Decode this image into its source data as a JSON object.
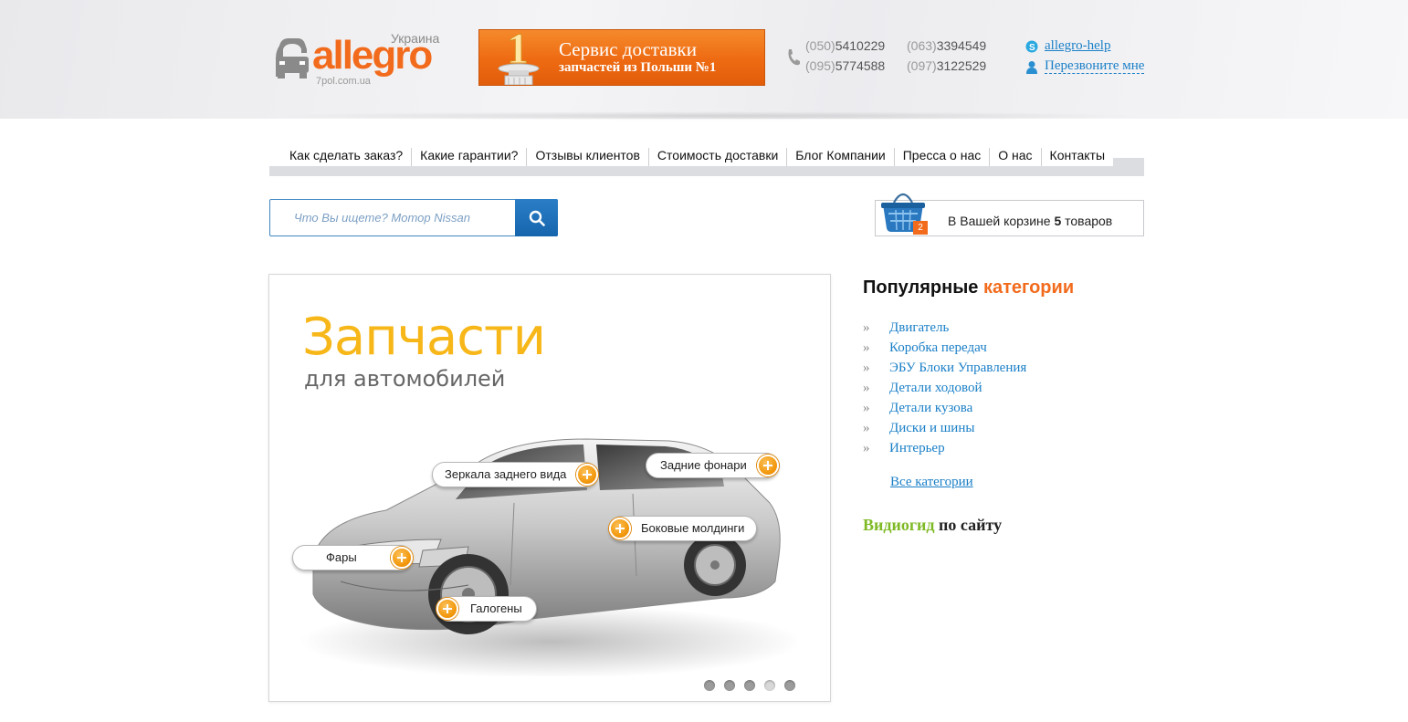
{
  "brand": {
    "name": "allegro",
    "country": "Украина",
    "domain": "7pol.com.ua",
    "color": "#f26b1d"
  },
  "promo": {
    "badge_number": "1",
    "line1": "Сервис доставки",
    "line2": "запчастей из Польши №1"
  },
  "phones": [
    {
      "code": "(050)",
      "number": "5410229"
    },
    {
      "code": "(063)",
      "number": "3394549"
    },
    {
      "code": "(095)",
      "number": "5774588"
    },
    {
      "code": "(097)",
      "number": "3122529"
    }
  ],
  "contacts": {
    "skype": "allegro-help",
    "callback": "Перезвоните мне"
  },
  "nav": [
    "Как сделать заказ?",
    "Какие гарантии?",
    "Отзывы клиентов",
    "Стоимость доставки",
    "Блог Компании",
    "Пресса о нас",
    "О нас",
    "Контакты"
  ],
  "search": {
    "placeholder": "Что Вы ищете? Мотор Nissan",
    "icon": "search-icon"
  },
  "cart": {
    "badge": "2",
    "text_before": "В Вашей корзине ",
    "count": "5",
    "text_after": " товаров"
  },
  "slider": {
    "title": "Запчасти",
    "subtitle": "для автомобилей",
    "hotspots": {
      "mirrors": "Зеркала заднего вида",
      "rear_lights": "Задние фонари",
      "moldings": "Боковые молдинги",
      "headlights": "Фары",
      "halogens": "Галогены"
    },
    "dots": 5,
    "active_dot": 4
  },
  "sidebar": {
    "title_part1": "Популярные ",
    "title_part2": "категории",
    "categories": [
      "Двигатель",
      "Коробка передач",
      "ЭБУ Блоки Управления",
      "Детали ходовой",
      "Детали кузова",
      "Диски и шины",
      "Интерьер"
    ],
    "all_categories": "Все категории",
    "video_part1": "Видиогид",
    "video_part2": " по сайту"
  },
  "colors": {
    "accent_orange": "#f26b1d",
    "link_blue": "#1a7fc7",
    "title_yellow": "#f7b718",
    "video_green": "#7fba26"
  }
}
